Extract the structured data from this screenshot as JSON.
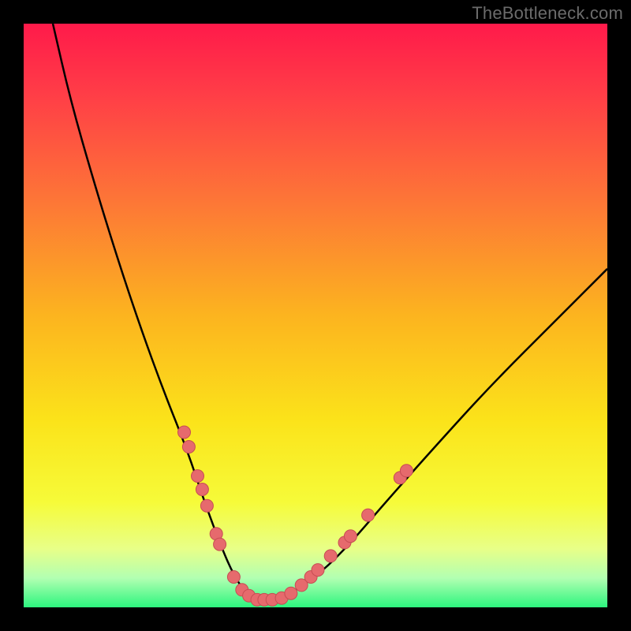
{
  "watermark": "TheBottleneck.com",
  "colors": {
    "background_black": "#000000",
    "curve": "#000000",
    "marker_fill": "#e66a6d",
    "marker_stroke": "#c74d53",
    "gradient_stops": [
      {
        "offset": "0%",
        "color": "#ff1a4a"
      },
      {
        "offset": "12%",
        "color": "#ff3d47"
      },
      {
        "offset": "30%",
        "color": "#fd7537"
      },
      {
        "offset": "50%",
        "color": "#fcb41f"
      },
      {
        "offset": "68%",
        "color": "#fbe31a"
      },
      {
        "offset": "82%",
        "color": "#f6fb39"
      },
      {
        "offset": "90%",
        "color": "#e8ff88"
      },
      {
        "offset": "95%",
        "color": "#b2ffb2"
      },
      {
        "offset": "100%",
        "color": "#2cf57e"
      }
    ]
  },
  "chart_data": {
    "type": "line",
    "title": "",
    "xlabel": "",
    "ylabel": "",
    "xlim": [
      0,
      100
    ],
    "ylim": [
      0,
      100
    ],
    "note": "V-shaped bottleneck curve with scattered hardware sample markers near the trough; background vertical gradient encodes bottleneck severity from red (high) at top to green (low) at bottom.",
    "series": [
      {
        "name": "bottleneck-curve",
        "x": [
          5,
          8,
          12,
          16,
          20,
          24,
          28,
          31,
          34,
          36,
          38,
          40,
          43,
          46,
          51,
          56,
          62,
          70,
          80,
          92,
          100
        ],
        "y": [
          100,
          87,
          73,
          60,
          48,
          37,
          27,
          18,
          10,
          5.5,
          2.5,
          1.2,
          1.2,
          2.5,
          6,
          11,
          18,
          27,
          38,
          50,
          58
        ]
      }
    ],
    "markers": {
      "name": "sample-points",
      "points": [
        {
          "x": 27.5,
          "y": 30.0
        },
        {
          "x": 28.3,
          "y": 27.5
        },
        {
          "x": 29.8,
          "y": 22.5
        },
        {
          "x": 30.6,
          "y": 20.2
        },
        {
          "x": 31.4,
          "y": 17.4
        },
        {
          "x": 33.0,
          "y": 12.6
        },
        {
          "x": 33.6,
          "y": 10.8
        },
        {
          "x": 36.0,
          "y": 5.2
        },
        {
          "x": 37.4,
          "y": 3.0
        },
        {
          "x": 38.6,
          "y": 2.0
        },
        {
          "x": 40.0,
          "y": 1.3
        },
        {
          "x": 41.2,
          "y": 1.3
        },
        {
          "x": 42.6,
          "y": 1.3
        },
        {
          "x": 44.2,
          "y": 1.6
        },
        {
          "x": 45.8,
          "y": 2.4
        },
        {
          "x": 47.6,
          "y": 3.8
        },
        {
          "x": 49.2,
          "y": 5.2
        },
        {
          "x": 50.4,
          "y": 6.4
        },
        {
          "x": 52.6,
          "y": 8.8
        },
        {
          "x": 55.0,
          "y": 11.1
        },
        {
          "x": 56.0,
          "y": 12.2
        },
        {
          "x": 59.0,
          "y": 15.8
        },
        {
          "x": 64.5,
          "y": 22.2
        },
        {
          "x": 65.6,
          "y": 23.4
        }
      ],
      "radius_px": 8
    }
  }
}
